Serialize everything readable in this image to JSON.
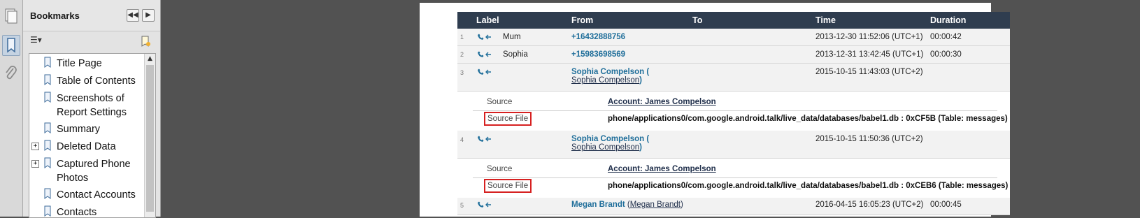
{
  "bookmarks_panel": {
    "title": "Bookmarks",
    "items": [
      {
        "label": "Title Page",
        "expandable": false
      },
      {
        "label": "Table of Contents",
        "expandable": false
      },
      {
        "label": "Screenshots of Report Settings",
        "expandable": false
      },
      {
        "label": "Summary",
        "expandable": false
      },
      {
        "label": "Deleted Data",
        "expandable": true
      },
      {
        "label": "Captured Phone Photos",
        "expandable": true
      },
      {
        "label": "Contact Accounts",
        "expandable": false
      },
      {
        "label": "Contacts",
        "expandable": false
      }
    ],
    "expander_symbol": "+"
  },
  "table": {
    "headers": {
      "label": "Label",
      "from": "From",
      "to": "To",
      "time": "Time",
      "duration": "Duration"
    },
    "rows": [
      {
        "index": "1",
        "label": "Mum",
        "from": "+16432888756",
        "from_sub": "",
        "time": "2013-12-30 11:52:06 (UTC+1)",
        "duration": "00:00:42"
      },
      {
        "index": "2",
        "label": "Sophia",
        "from": "+15983698569",
        "from_sub": "",
        "time": "2013-12-31 13:42:45 (UTC+1)",
        "duration": "00:00:30"
      },
      {
        "index": "3",
        "label": "",
        "from": "Sophia Compelson (",
        "from_sub": "Sophia Compelson",
        "from_close": ")",
        "time": "2015-10-15 11:43:03 (UTC+2)",
        "duration": "",
        "source_label": "Source",
        "source_value": "Account: James Compelson",
        "source_file_label": "Source File",
        "source_file_value": "phone/applications0/com.google.android.talk/live_data/databases/babel1.db : 0xCF5B (Table: messages)"
      },
      {
        "index": "4",
        "label": "",
        "from": "Sophia Compelson (",
        "from_sub": "Sophia Compelson",
        "from_close": ")",
        "time": "2015-10-15 11:50:36 (UTC+2)",
        "duration": "",
        "source_label": "Source",
        "source_value": "Account: James Compelson",
        "source_file_label": "Source File",
        "source_file_value": "phone/applications0/com.google.android.talk/live_data/databases/babel1.db : 0xCEB6 (Table: messages)"
      },
      {
        "index": "5",
        "label": "",
        "from": "Megan Brandt",
        "from_sub": "Megan Brandt",
        "time": "2016-04-15 16:05:23 (UTC+2)",
        "duration": "00:00:45"
      }
    ]
  },
  "colors": {
    "header_bg": "#2f3d4f",
    "link": "#1f6e9a",
    "highlight_box": "#d62020",
    "canvas": "#525252"
  },
  "icons": [
    "phone-icon",
    "incoming-arrow-icon",
    "bookmark-icon",
    "attachment-icon",
    "pages-icon"
  ]
}
